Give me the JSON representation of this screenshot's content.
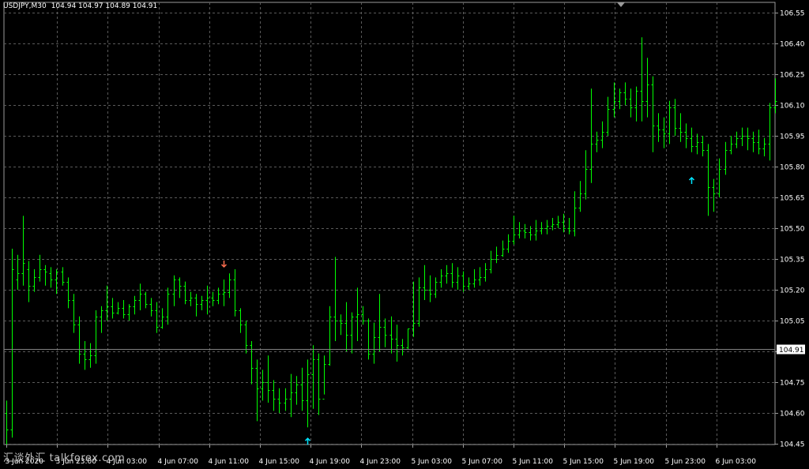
{
  "header": {
    "symbol_timeframe": "USDJPY,M30",
    "ohlc": "104.94 104.97 104.89 104.91"
  },
  "watermark": "汇谈外汇 talkforex.com",
  "colors": {
    "background": "#000000",
    "bars": "#00ff00",
    "grid": "#5a5a5a",
    "axis_text": "#ffffff",
    "price_line": "#808080",
    "price_label_bg": "#ffffff",
    "price_label_fg": "#000000",
    "sell_arrow": "#ff6f50",
    "buy_arrow": "#00e5ff"
  },
  "chart_data": {
    "type": "ohlc-bar",
    "symbol": "USDJPY",
    "timeframe": "M30",
    "current_price": "104.91",
    "y_ticks": [
      "106.55",
      "106.40",
      "106.25",
      "106.10",
      "105.95",
      "105.80",
      "105.65",
      "105.50",
      "105.35",
      "105.20",
      "105.05",
      "104.90",
      "104.75",
      "104.60",
      "104.45"
    ],
    "x_ticks": [
      "3 Jun 2020",
      "3 Jun 23:00",
      "4 Jun 03:00",
      "4 Jun 07:00",
      "4 Jun 11:00",
      "4 Jun 15:00",
      "4 Jun 19:00",
      "4 Jun 23:00",
      "5 Jun 03:00",
      "5 Jun 07:00",
      "5 Jun 11:00",
      "5 Jun 15:00",
      "5 Jun 19:00",
      "5 Jun 23:00",
      "6 Jun 03:00"
    ],
    "ylim": [
      104.42,
      106.58
    ],
    "bars": [
      [
        104.6,
        104.66,
        104.44,
        104.52
      ],
      [
        104.52,
        105.4,
        104.48,
        105.3
      ],
      [
        105.25,
        105.37,
        105.2,
        105.28
      ],
      [
        105.28,
        105.56,
        105.22,
        105.33
      ],
      [
        105.3,
        105.34,
        105.14,
        105.22
      ],
      [
        105.22,
        105.3,
        105.19,
        105.26
      ],
      [
        105.26,
        105.37,
        105.24,
        105.3
      ],
      [
        105.3,
        105.32,
        105.22,
        105.29
      ],
      [
        105.28,
        105.31,
        105.21,
        105.25
      ],
      [
        105.25,
        105.3,
        105.18,
        105.29
      ],
      [
        105.29,
        105.31,
        105.22,
        105.24
      ],
      [
        105.24,
        105.26,
        105.11,
        105.15
      ],
      [
        105.15,
        105.18,
        104.99,
        105.03
      ],
      [
        105.03,
        105.07,
        104.84,
        104.89
      ],
      [
        104.89,
        104.95,
        104.81,
        104.86
      ],
      [
        104.86,
        104.94,
        104.82,
        104.88
      ],
      [
        104.88,
        105.1,
        104.84,
        105.07
      ],
      [
        105.07,
        105.12,
        104.99,
        105.1
      ],
      [
        105.1,
        105.22,
        105.05,
        105.12
      ],
      [
        105.12,
        105.16,
        105.06,
        105.09
      ],
      [
        105.09,
        105.14,
        105.08,
        105.11
      ],
      [
        105.11,
        105.15,
        105.06,
        105.08
      ],
      [
        105.08,
        105.13,
        105.05,
        105.12
      ],
      [
        105.12,
        105.17,
        105.08,
        105.15
      ],
      [
        105.15,
        105.23,
        105.1,
        105.18
      ],
      [
        105.18,
        105.19,
        105.11,
        105.13
      ],
      [
        105.13,
        105.16,
        105.07,
        105.1
      ],
      [
        105.1,
        105.14,
        104.99,
        105.02
      ],
      [
        105.02,
        105.11,
        105.01,
        105.07
      ],
      [
        105.07,
        105.21,
        105.03,
        105.18
      ],
      [
        105.18,
        105.27,
        105.12,
        105.25
      ],
      [
        105.25,
        105.26,
        105.16,
        105.22
      ],
      [
        105.22,
        105.24,
        105.13,
        105.15
      ],
      [
        105.15,
        105.19,
        105.12,
        105.16
      ],
      [
        105.16,
        105.18,
        105.07,
        105.13
      ],
      [
        105.13,
        105.17,
        105.1,
        105.15
      ],
      [
        105.15,
        105.22,
        105.08,
        105.16
      ],
      [
        105.16,
        105.19,
        105.12,
        105.15
      ],
      [
        105.15,
        105.21,
        105.13,
        105.18
      ],
      [
        105.18,
        105.25,
        105.12,
        105.19
      ],
      [
        105.19,
        105.28,
        105.16,
        105.25
      ],
      [
        105.25,
        105.3,
        105.07,
        105.1
      ],
      [
        105.1,
        105.11,
        104.99,
        105.03
      ],
      [
        105.03,
        105.05,
        104.89,
        104.93
      ],
      [
        104.93,
        104.95,
        104.74,
        104.82
      ],
      [
        104.82,
        104.86,
        104.56,
        104.72
      ],
      [
        104.72,
        104.81,
        104.66,
        104.75
      ],
      [
        104.75,
        104.88,
        104.65,
        104.71
      ],
      [
        104.71,
        104.76,
        104.61,
        104.67
      ],
      [
        104.67,
        104.72,
        104.6,
        104.65
      ],
      [
        104.65,
        104.72,
        104.61,
        104.67
      ],
      [
        104.67,
        104.79,
        104.58,
        104.7
      ],
      [
        104.7,
        104.78,
        104.64,
        104.74
      ],
      [
        104.74,
        104.82,
        104.61,
        104.66
      ],
      [
        104.66,
        104.86,
        104.53,
        104.79
      ],
      [
        104.79,
        104.93,
        104.62,
        104.86
      ],
      [
        104.86,
        104.89,
        104.59,
        104.67
      ],
      [
        104.67,
        104.88,
        104.69,
        104.84
      ],
      [
        104.84,
        105.12,
        104.83,
        105.07
      ],
      [
        105.07,
        105.36,
        104.95,
        105.05
      ],
      [
        105.05,
        105.08,
        104.98,
        105.04
      ],
      [
        105.04,
        105.14,
        104.9,
        104.98
      ],
      [
        104.98,
        105.09,
        104.89,
        105.07
      ],
      [
        105.07,
        105.21,
        104.95,
        105.08
      ],
      [
        105.08,
        105.12,
        105.03,
        105.05
      ],
      [
        105.05,
        105.06,
        104.86,
        104.89
      ],
      [
        104.89,
        105.04,
        104.84,
        104.97
      ],
      [
        104.97,
        105.18,
        104.9,
        105.02
      ],
      [
        105.02,
        105.06,
        104.92,
        104.98
      ],
      [
        104.98,
        105.07,
        104.89,
        104.96
      ],
      [
        104.96,
        105.03,
        104.85,
        104.93
      ],
      [
        104.93,
        104.96,
        104.88,
        104.92
      ],
      [
        104.92,
        105.01,
        104.91,
        105.01
      ],
      [
        105.01,
        105.24,
        104.97,
        105.04
      ],
      [
        105.04,
        105.26,
        105.02,
        105.21
      ],
      [
        105.21,
        105.32,
        105.15,
        105.2
      ],
      [
        105.2,
        105.27,
        105.14,
        105.18
      ],
      [
        105.18,
        105.26,
        105.16,
        105.24
      ],
      [
        105.24,
        105.3,
        105.21,
        105.27
      ],
      [
        105.27,
        105.32,
        105.23,
        105.28
      ],
      [
        105.28,
        105.33,
        105.21,
        105.24
      ],
      [
        105.24,
        105.31,
        105.2,
        105.27
      ],
      [
        105.27,
        105.29,
        105.19,
        105.22
      ],
      [
        105.22,
        105.26,
        105.2,
        105.23
      ],
      [
        105.23,
        105.3,
        105.21,
        105.25
      ],
      [
        105.25,
        105.31,
        105.22,
        105.26
      ],
      [
        105.26,
        105.33,
        105.24,
        105.3
      ],
      [
        105.3,
        105.39,
        105.28,
        105.35
      ],
      [
        105.35,
        105.41,
        105.33,
        105.37
      ],
      [
        105.37,
        105.44,
        105.36,
        105.4
      ],
      [
        105.4,
        105.47,
        105.38,
        105.44
      ],
      [
        105.44,
        105.56,
        105.42,
        105.47
      ],
      [
        105.47,
        105.53,
        105.45,
        105.49
      ],
      [
        105.49,
        105.52,
        105.45,
        105.48
      ],
      [
        105.48,
        105.51,
        105.44,
        105.47
      ],
      [
        105.47,
        105.54,
        105.44,
        105.49
      ],
      [
        105.49,
        105.53,
        105.47,
        105.5
      ],
      [
        105.5,
        105.54,
        105.47,
        105.51
      ],
      [
        105.51,
        105.55,
        105.49,
        105.52
      ],
      [
        105.52,
        105.56,
        105.5,
        105.53
      ],
      [
        105.53,
        105.57,
        105.48,
        105.5
      ],
      [
        105.5,
        105.55,
        105.47,
        105.49
      ],
      [
        105.49,
        105.68,
        105.46,
        105.6
      ],
      [
        105.6,
        105.73,
        105.58,
        105.67
      ],
      [
        105.67,
        105.88,
        105.64,
        105.79
      ],
      [
        105.79,
        106.18,
        105.72,
        105.91
      ],
      [
        105.91,
        105.97,
        105.87,
        105.93
      ],
      [
        105.93,
        106.02,
        105.89,
        105.97
      ],
      [
        105.97,
        106.14,
        105.95,
        106.08
      ],
      [
        106.08,
        106.21,
        106.04,
        106.12
      ],
      [
        106.12,
        106.18,
        106.08,
        106.16
      ],
      [
        106.16,
        106.21,
        106.1,
        106.13
      ],
      [
        106.13,
        106.18,
        106.04,
        106.09
      ],
      [
        106.09,
        106.19,
        106.02,
        106.17
      ],
      [
        106.17,
        106.43,
        106.02,
        106.12
      ],
      [
        106.12,
        106.33,
        106.04,
        106.2
      ],
      [
        106.2,
        106.24,
        105.87,
        106.0
      ],
      [
        106.0,
        106.06,
        105.92,
        105.98
      ],
      [
        105.98,
        106.04,
        105.89,
        105.96
      ],
      [
        105.96,
        106.12,
        105.91,
        106.09
      ],
      [
        106.09,
        106.13,
        105.95,
        105.99
      ],
      [
        105.99,
        106.06,
        105.92,
        105.97
      ],
      [
        105.97,
        106.01,
        105.89,
        105.94
      ],
      [
        105.94,
        105.99,
        105.87,
        105.9
      ],
      [
        105.9,
        105.96,
        105.86,
        105.92
      ],
      [
        105.92,
        105.95,
        105.85,
        105.88
      ],
      [
        105.88,
        105.91,
        105.56,
        105.7
      ],
      [
        105.7,
        105.74,
        105.58,
        105.67
      ],
      [
        105.67,
        105.84,
        105.65,
        105.79
      ],
      [
        105.79,
        105.92,
        105.76,
        105.88
      ],
      [
        105.88,
        105.95,
        105.86,
        105.91
      ],
      [
        105.91,
        105.97,
        105.89,
        105.94
      ],
      [
        105.94,
        105.99,
        105.9,
        105.95
      ],
      [
        105.95,
        105.99,
        105.88,
        105.94
      ],
      [
        105.94,
        105.97,
        105.87,
        105.92
      ],
      [
        105.92,
        105.98,
        105.86,
        105.89
      ],
      [
        105.89,
        105.94,
        105.85,
        105.91
      ],
      [
        105.91,
        106.11,
        105.83,
        106.09
      ],
      [
        106.09,
        106.23,
        106.06,
        106.12
      ]
    ],
    "arrows": [
      {
        "type": "sell",
        "bar": 39,
        "price": 105.3
      },
      {
        "type": "buy",
        "bar": 54,
        "price": 104.53
      },
      {
        "type": "buy",
        "bar": 123,
        "price": 105.8
      }
    ]
  }
}
